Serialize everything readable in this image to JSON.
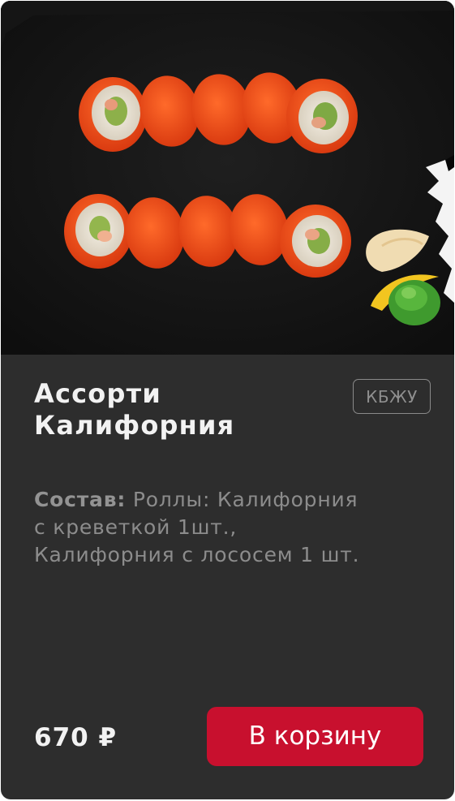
{
  "product": {
    "title_line1": "Ассорти",
    "title_line2": "Калифорния",
    "kbju_label": "КБЖУ",
    "composition_label": "Состав:",
    "composition_line1": " Роллы: Калифорния",
    "composition_line2": "с креветкой 1шт.,",
    "composition_line3": "Калифорния с лососем 1 шт.",
    "price": "670 ₽",
    "cart_button_label": "В корзину"
  },
  "colors": {
    "card_background": "#2d2d2d",
    "photo_background": "#070707",
    "accent": "#c8102e",
    "title_text": "#f2f2f2",
    "muted_text": "#8c8c8c"
  },
  "image": {
    "subject": "sushi-rolls-photo"
  }
}
